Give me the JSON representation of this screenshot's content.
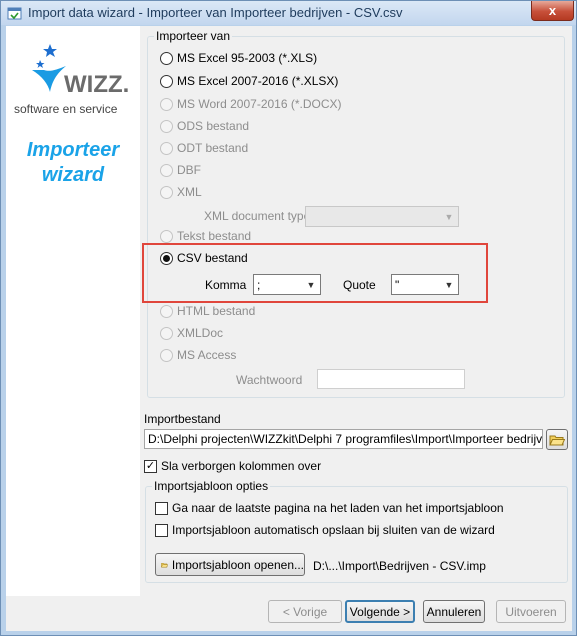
{
  "window": {
    "title": "Import data wizard - Importeer van Importeer bedrijven - CSV.csv",
    "close_glyph": "x"
  },
  "sidebar": {
    "logo_text": "WIZZ.",
    "tagline": "software en service",
    "title": "Importeer wizard"
  },
  "import_from": {
    "legend": "Importeer van",
    "options": [
      {
        "label": "MS Excel 95-2003 (*.XLS)",
        "enabled": true,
        "selected": false
      },
      {
        "label": "MS Excel 2007-2016 (*.XLSX)",
        "enabled": true,
        "selected": false
      },
      {
        "label": "MS Word 2007-2016 (*.DOCX)",
        "enabled": false,
        "selected": false
      },
      {
        "label": "ODS bestand",
        "enabled": false,
        "selected": false
      },
      {
        "label": "ODT bestand",
        "enabled": false,
        "selected": false
      },
      {
        "label": "DBF",
        "enabled": false,
        "selected": false
      },
      {
        "label": "XML",
        "enabled": false,
        "selected": false
      },
      {
        "label": "Tekst bestand",
        "enabled": false,
        "selected": false
      },
      {
        "label": "CSV bestand",
        "enabled": true,
        "selected": true
      },
      {
        "label": "HTML bestand",
        "enabled": false,
        "selected": false
      },
      {
        "label": "XMLDoc",
        "enabled": false,
        "selected": false
      },
      {
        "label": "MS Access",
        "enabled": false,
        "selected": false
      }
    ],
    "xml_doc_type_label": "XML document type",
    "xml_doc_type_value": "",
    "komma_label": "Komma",
    "komma_value": ";",
    "quote_label": "Quote",
    "quote_value": "\"",
    "password_label": "Wachtwoord",
    "password_value": ""
  },
  "import_file": {
    "label": "Importbestand",
    "value": "D:\\Delphi projecten\\WIZZkit\\Delphi 7 programfiles\\Import\\Importeer bedrijven - CSV.csv"
  },
  "skip_hidden_columns": {
    "label": "Sla verborgen kolommen over",
    "checked": true,
    "check_glyph": "✓"
  },
  "template_options": {
    "legend": "Importsjabloon opties",
    "goto_last_page_label": "Ga naar de laatste pagina na het laden van het importsjabloon",
    "autosave_label": "Importsjabloon automatisch opslaan bij sluiten van de wizard",
    "open_button_label": "Importsjabloon openen...",
    "template_path": "D:\\...\\Import\\Bedrijven - CSV.imp"
  },
  "footer": {
    "prev_label": "< Vorige",
    "next_label": "Volgende >",
    "cancel_label": "Annuleren",
    "execute_label": "Uitvoeren"
  },
  "colors": {
    "accent": "#1aa3e8",
    "highlight": "#e0463c",
    "close": "#c7503a"
  }
}
